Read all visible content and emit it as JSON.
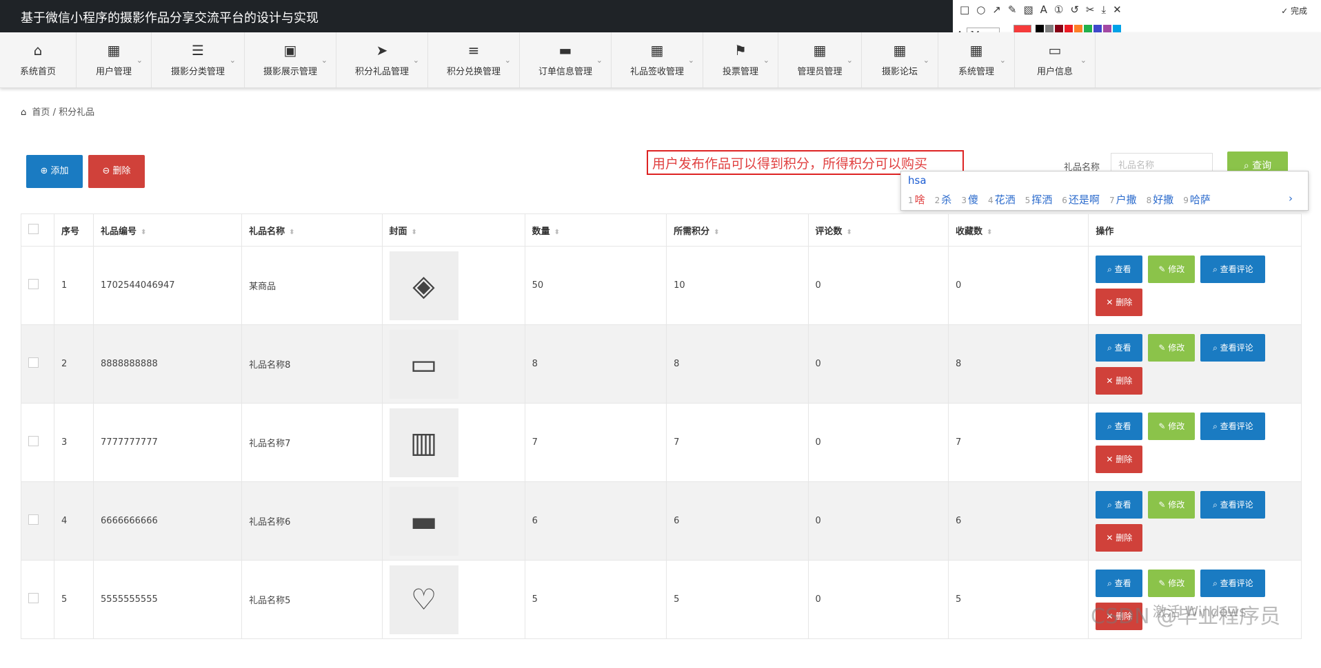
{
  "app": {
    "title": "基于微信小程序的摄影作品分享交流平台的设计与实现"
  },
  "toolbar": {
    "done_label": "完成",
    "font_size": "14",
    "current_color": "#f63b3b",
    "palette": [
      "#000000",
      "#7f7f7f",
      "#880015",
      "#ed1c24",
      "#ff7f27",
      "#22b14c",
      "#3f48cc",
      "#a349a4",
      "#00a2e8",
      "#ffffff",
      "#c3c3c3",
      "#b5e61d",
      "#ff0000",
      "#fff200",
      "#22b14c",
      "#4472c4",
      "#e040fb",
      "#40c4c4"
    ]
  },
  "nav": {
    "items": [
      {
        "label": "系统首页",
        "icon": "⌂",
        "has_chevron": false
      },
      {
        "label": "用户管理",
        "icon": "▦",
        "has_chevron": true
      },
      {
        "label": "摄影分类管理",
        "icon": "☰",
        "has_chevron": true
      },
      {
        "label": "摄影展示管理",
        "icon": "▣",
        "has_chevron": true
      },
      {
        "label": "积分礼品管理",
        "icon": "➤",
        "has_chevron": true
      },
      {
        "label": "积分兑换管理",
        "icon": "≡",
        "has_chevron": true
      },
      {
        "label": "订单信息管理",
        "icon": "▬",
        "has_chevron": true
      },
      {
        "label": "礼品签收管理",
        "icon": "▦",
        "has_chevron": true
      },
      {
        "label": "投票管理",
        "icon": "⚑",
        "has_chevron": true
      },
      {
        "label": "管理员管理",
        "icon": "▦",
        "has_chevron": true
      },
      {
        "label": "摄影论坛",
        "icon": "▦",
        "has_chevron": true
      },
      {
        "label": "系统管理",
        "icon": "▦",
        "has_chevron": true
      },
      {
        "label": "用户信息",
        "icon": "▭",
        "has_chevron": true
      }
    ]
  },
  "breadcrumb": {
    "home": "首页",
    "separator": "/",
    "current": "积分礼品"
  },
  "actions": {
    "add_label": "添加",
    "delete_label": "删除"
  },
  "annotation": {
    "text": "用户发布作品可以得到积分，所得积分可以购买"
  },
  "search": {
    "label": "礼品名称",
    "placeholder": "礼品名称",
    "button_label": "查询"
  },
  "ime": {
    "code": "hsa",
    "candidates": [
      {
        "num": "1",
        "text": "啥"
      },
      {
        "num": "2",
        "text": "杀"
      },
      {
        "num": "3",
        "text": "傻"
      },
      {
        "num": "4",
        "text": "花洒"
      },
      {
        "num": "5",
        "text": "挥洒"
      },
      {
        "num": "6",
        "text": "还是啊"
      },
      {
        "num": "7",
        "text": "户撒"
      },
      {
        "num": "8",
        "text": "好撒"
      },
      {
        "num": "9",
        "text": "哈萨"
      }
    ]
  },
  "table": {
    "columns": [
      "序号",
      "礼品编号",
      "礼品名称",
      "封面",
      "数量",
      "所需积分",
      "评论数",
      "收藏数",
      "操作"
    ],
    "op_labels": {
      "view": "查看",
      "edit": "修改",
      "comments": "查看评论",
      "delete": "删除"
    },
    "rows": [
      {
        "index": "1",
        "code": "1702544046947",
        "name": "某商品",
        "cover_icon": "necklace-icon",
        "cover_glyph": "◈",
        "quantity": "50",
        "points": "10",
        "comments": "0",
        "favorites": "0"
      },
      {
        "index": "2",
        "code": "8888888888",
        "name": "礼品名称8",
        "cover_icon": "tv-icon",
        "cover_glyph": "▭",
        "quantity": "8",
        "points": "8",
        "comments": "0",
        "favorites": "8"
      },
      {
        "index": "3",
        "code": "7777777777",
        "name": "礼品名称7",
        "cover_icon": "cabinet-icon",
        "cover_glyph": "▥",
        "quantity": "7",
        "points": "7",
        "comments": "0",
        "favorites": "7"
      },
      {
        "index": "4",
        "code": "6666666666",
        "name": "礼品名称6",
        "cover_icon": "air-conditioner-icon",
        "cover_glyph": "▬",
        "quantity": "6",
        "points": "6",
        "comments": "0",
        "favorites": "6"
      },
      {
        "index": "5",
        "code": "5555555555",
        "name": "礼品名称5",
        "cover_icon": "pendant-icon",
        "cover_glyph": "♡",
        "quantity": "5",
        "points": "5",
        "comments": "0",
        "favorites": "5"
      }
    ]
  },
  "overlay": {
    "windows_activate": "激活 Windows",
    "watermark": "CSDN @毕业程序员"
  }
}
